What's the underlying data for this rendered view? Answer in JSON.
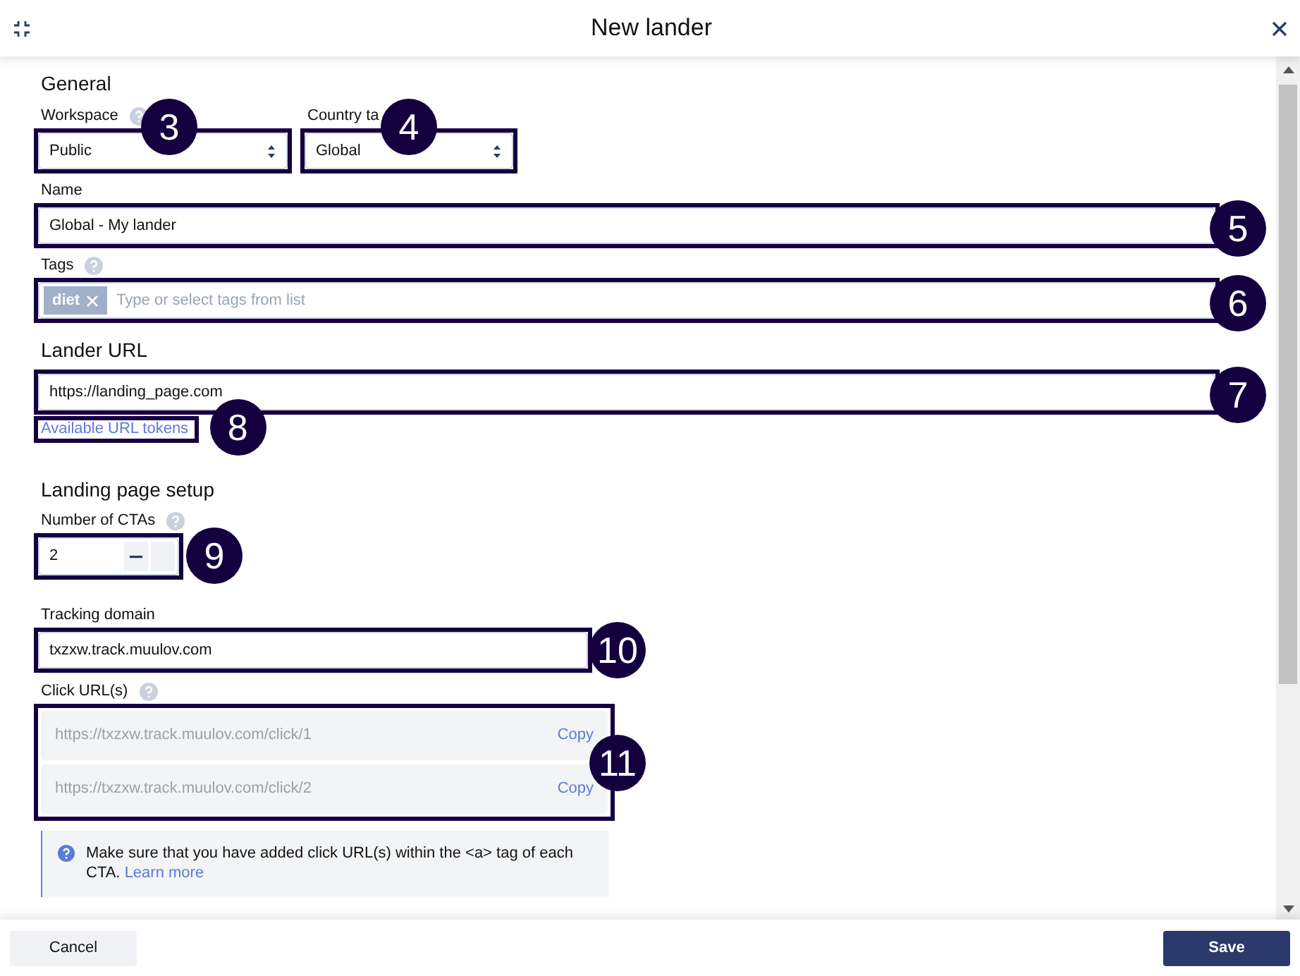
{
  "header": {
    "title": "New lander"
  },
  "general": {
    "title": "General",
    "workspace": {
      "label": "Workspace",
      "value": "Public",
      "callout": "3"
    },
    "country": {
      "label": "Country ta",
      "value": "Global",
      "callout": "4"
    },
    "name": {
      "label": "Name",
      "value": "Global - My lander",
      "callout": "5"
    },
    "tags": {
      "label": "Tags",
      "chips": [
        "diet"
      ],
      "placeholder": "Type or select tags from list",
      "callout": "6"
    }
  },
  "lander_url": {
    "title": "Lander URL",
    "value": "https://landing_page.com",
    "callout": "7",
    "link": "Available URL tokens",
    "link_callout": "8"
  },
  "setup": {
    "title": "Landing page setup",
    "ctas": {
      "label": "Number of CTAs",
      "value": "2",
      "callout": "9"
    },
    "tracking": {
      "label": "Tracking domain",
      "value": "txzxw.track.muulov.com",
      "callout": "10"
    },
    "click_urls": {
      "label": "Click URL(s)",
      "callout": "11",
      "rows": [
        {
          "url": "https://txzxw.track.muulov.com/click/1",
          "action": "Copy"
        },
        {
          "url": "https://txzxw.track.muulov.com/click/2",
          "action": "Copy"
        }
      ]
    },
    "info": {
      "text": "Make sure that you have added click URL(s) within the <a> tag of each CTA.",
      "link": "Learn more"
    }
  },
  "footer": {
    "cancel": "Cancel",
    "save": "Save"
  }
}
